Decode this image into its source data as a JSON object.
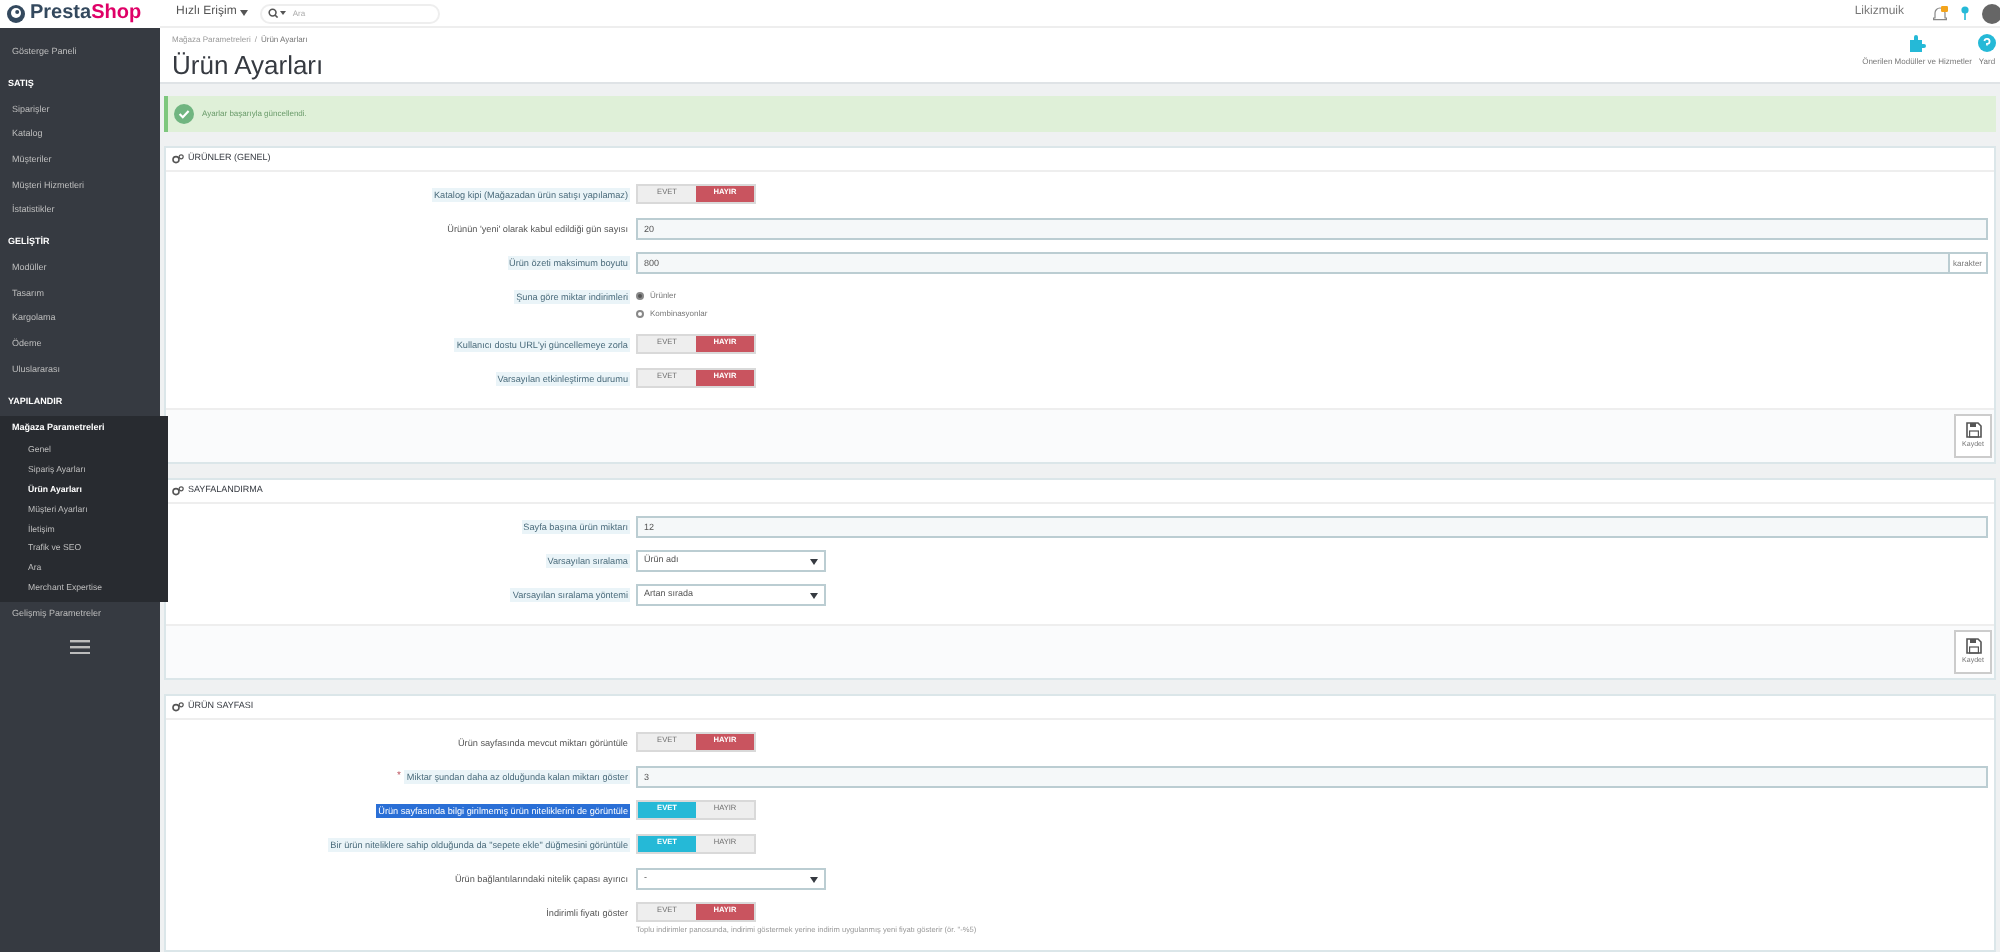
{
  "logo": {
    "text": "Presta",
    "accent": "Shop"
  },
  "topbar": {
    "quick_access": "Hızlı Erişim",
    "search_placeholder": "Ara",
    "user": "Likizmuik"
  },
  "breadcrumb": [
    "Mağaza Parametreleri",
    "/",
    "Ürün Ayarları"
  ],
  "page_title": "Ürün Ayarları",
  "toolbar": [
    "Önerilen Modüller ve Hizmetler",
    "Yard"
  ],
  "sidebar": {
    "items": [
      {
        "kind": "link",
        "label": "Gösterge Paneli",
        "selected": false
      },
      {
        "kind": "heading",
        "label": "SATIŞ"
      },
      {
        "kind": "link",
        "label": "Siparişler",
        "selected": false
      },
      {
        "kind": "link",
        "label": "Katalog",
        "selected": false
      },
      {
        "kind": "link",
        "label": "Müşteriler",
        "selected": false
      },
      {
        "kind": "link",
        "label": "Müşteri Hizmetleri",
        "selected": false
      },
      {
        "kind": "link",
        "label": "İstatistikler",
        "selected": false
      },
      {
        "kind": "heading",
        "label": "GELİŞTİR"
      },
      {
        "kind": "link",
        "label": "Modüller",
        "selected": false
      },
      {
        "kind": "link",
        "label": "Tasarım",
        "selected": false
      },
      {
        "kind": "link",
        "label": "Kargolama",
        "selected": false
      },
      {
        "kind": "link",
        "label": "Ödeme",
        "selected": false
      },
      {
        "kind": "link",
        "label": "Uluslararası",
        "selected": false
      },
      {
        "kind": "heading",
        "label": "YAPILANDIR"
      },
      {
        "kind": "link",
        "label": "Mağaza Parametreleri",
        "selected": true,
        "children": [
          {
            "label": "Genel",
            "selected": false
          },
          {
            "label": "Sipariş Ayarları",
            "selected": false
          },
          {
            "label": "Ürün Ayarları",
            "selected": true
          },
          {
            "label": "Müşteri Ayarları",
            "selected": false
          },
          {
            "label": "İletişim",
            "selected": false
          },
          {
            "label": "Trafik ve SEO",
            "selected": false
          },
          {
            "label": "Ara",
            "selected": false
          },
          {
            "label": "Merchant Expertise",
            "selected": false
          }
        ]
      },
      {
        "kind": "link",
        "label": "Gelişmiş Parametreler",
        "selected": false
      }
    ]
  },
  "alert": "Ayarlar başarıyla güncellendi.",
  "sections": [
    {
      "title": "ÜRÜNLER (GENEL)",
      "save": "Kaydet",
      "rows": [
        {
          "kind": "switch",
          "label": "Katalog kipi (Mağazadan ürün satışı yapılamaz)",
          "hint": true,
          "yes": "EVET",
          "no": "HAYIR",
          "on": false
        },
        {
          "kind": "text",
          "label": "Ürünün 'yeni' olarak kabul edildiği gün sayısı",
          "hint": false,
          "value": "20"
        },
        {
          "kind": "text",
          "label": "Ürün özeti maksimum boyutu",
          "hint": true,
          "value": "800",
          "suffix": "karakter"
        },
        {
          "kind": "radio",
          "label": "Şuna göre miktar indirimleri",
          "hint": true,
          "options": [
            {
              "label": "Ürünler",
              "selected": true
            },
            {
              "label": "Kombinasyonlar",
              "selected": false
            }
          ]
        },
        {
          "kind": "switch",
          "label": "Kullanıcı dostu URL'yi güncellemeye zorla",
          "hint": true,
          "yes": "EVET",
          "no": "HAYIR",
          "on": false
        },
        {
          "kind": "switch",
          "label": "Varsayılan etkinleştirme durumu",
          "hint": true,
          "yes": "EVET",
          "no": "HAYIR",
          "on": false
        }
      ]
    },
    {
      "title": "SAYFALANDIRMA",
      "save": "Kaydet",
      "rows": [
        {
          "kind": "text",
          "label": "Sayfa başına ürün miktarı",
          "hint": true,
          "value": "12"
        },
        {
          "kind": "select",
          "label": "Varsayılan sıralama",
          "hint": true,
          "value": "Ürün adı"
        },
        {
          "kind": "select",
          "label": "Varsayılan sıralama yöntemi",
          "hint": true,
          "value": "Artan sırada"
        }
      ]
    },
    {
      "title": "ÜRÜN SAYFASI",
      "rows": [
        {
          "kind": "switch",
          "label": "Ürün sayfasında mevcut miktarı görüntüle",
          "hint": false,
          "yes": "EVET",
          "no": "HAYIR",
          "on": false
        },
        {
          "kind": "text",
          "label": "Miktar şundan daha az olduğunda kalan miktarı göster",
          "hint": true,
          "required_mark": "*",
          "value": "3"
        },
        {
          "kind": "switch",
          "label": "Ürün sayfasında bilgi girilmemiş ürün niteliklerini de görüntüle",
          "highlighted": true,
          "yes": "EVET",
          "no": "HAYIR",
          "on": true
        },
        {
          "kind": "switch",
          "label": "Bir ürün niteliklere sahip olduğunda da \"sepete ekle\" düğmesini görüntüle",
          "hint": true,
          "yes": "EVET",
          "no": "HAYIR",
          "on": true
        },
        {
          "kind": "select",
          "label": "Ürün bağlantılarındaki nitelik çapası ayırıcı",
          "hint": false,
          "value": "-"
        },
        {
          "kind": "switch",
          "label": "İndirimli fiyatı göster",
          "hint": false,
          "yes": "EVET",
          "no": "HAYIR",
          "on": false,
          "help": "Toplu indirimler panosunda, indirimi göstermek yerine indirim uygulanmış yeni fiyatı gösterir (ör. \"-%5)"
        }
      ]
    }
  ]
}
